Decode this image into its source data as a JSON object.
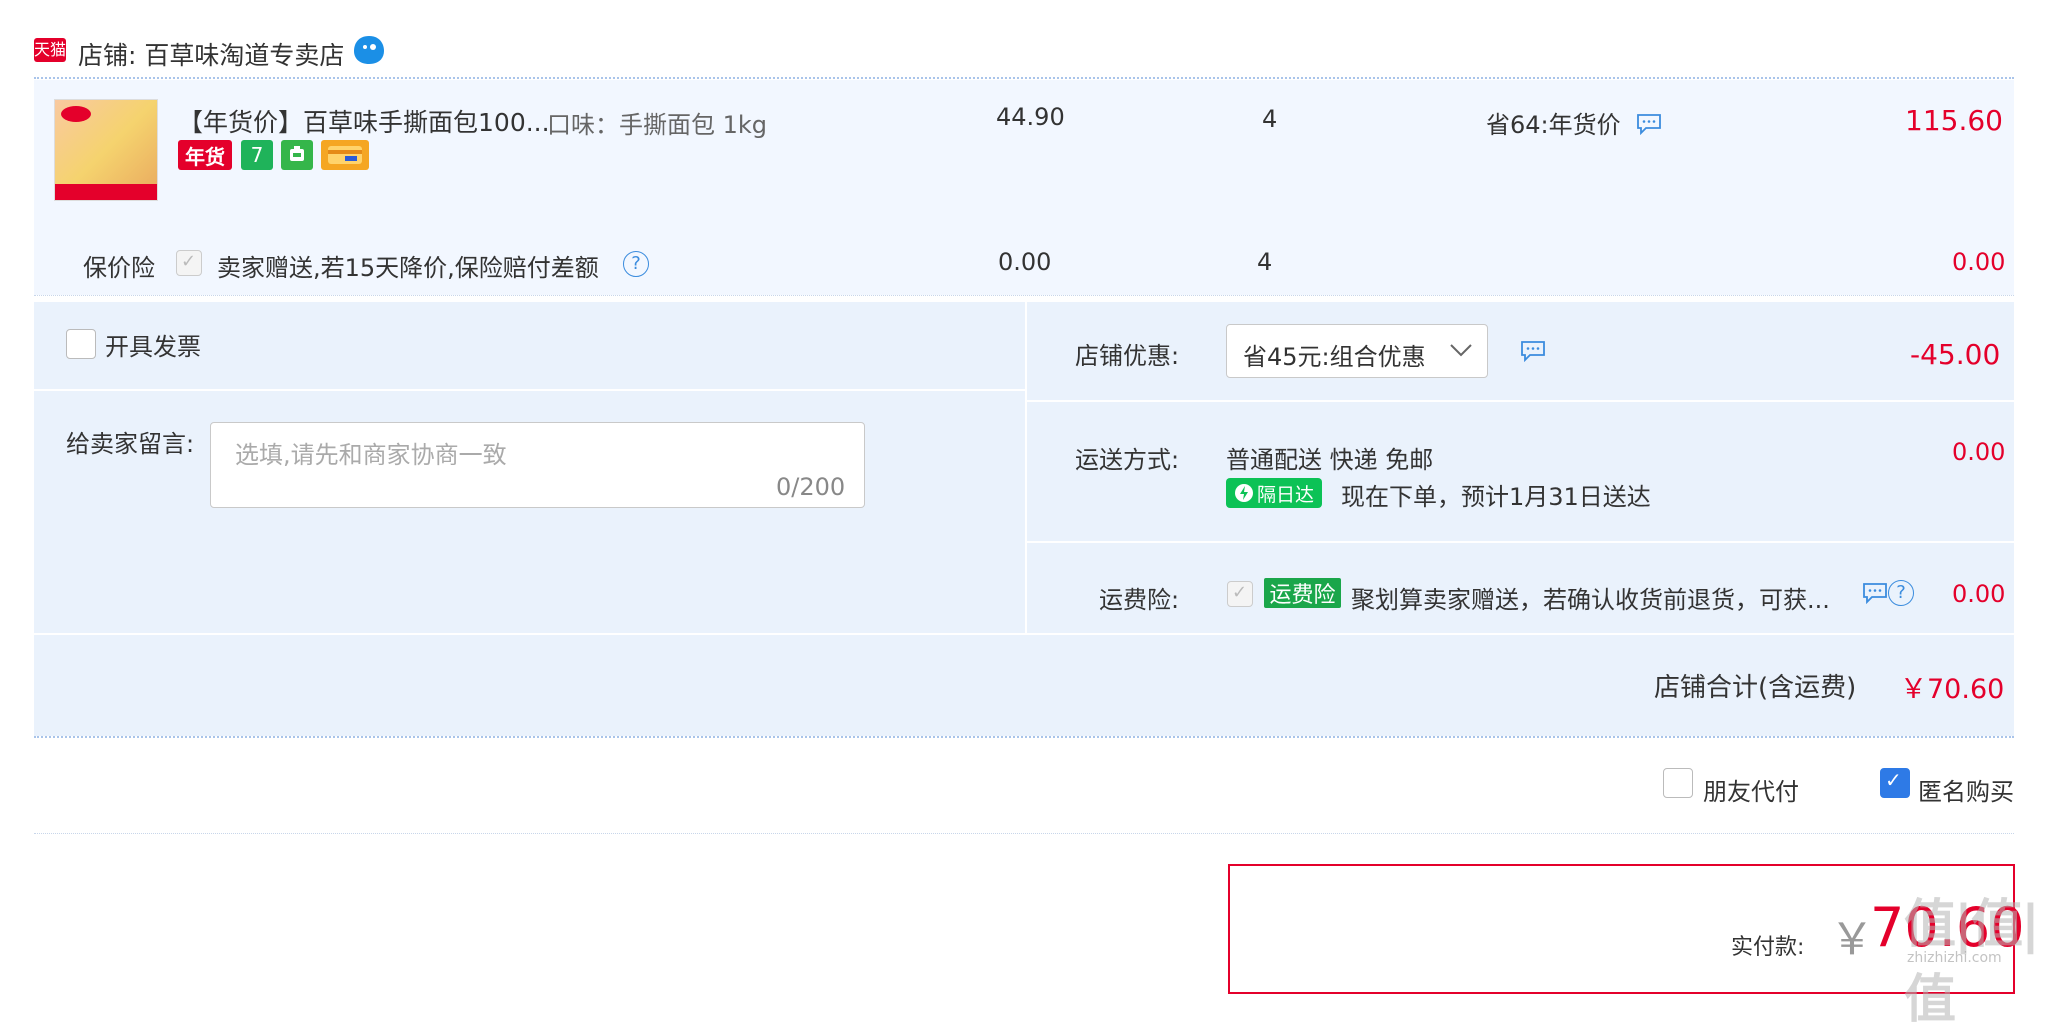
{
  "shop": {
    "logo_text": "天猫",
    "label": "店铺: 百草味淘道专卖店"
  },
  "item": {
    "title": "【年货价】百草味手撕面包100...",
    "sku": "口味：手撕面包 1kg",
    "badges": [
      "年货",
      "7",
      "",
      ""
    ],
    "price": "44.90",
    "quantity": "4",
    "promo": "省64:年货价",
    "subtotal": "115.60"
  },
  "insurance": {
    "label": "保价险",
    "text": "卖家赠送,若15天降价,保险赔付差额",
    "price": "0.00",
    "quantity": "4",
    "total": "0.00"
  },
  "invoice": {
    "label": "开具发票"
  },
  "memo": {
    "label": "给卖家留言:",
    "placeholder": "选填,请先和商家协商一致",
    "count": "0/200"
  },
  "discount": {
    "label": "店铺优惠:",
    "selected": "省45元:组合优惠",
    "total": "-45.00"
  },
  "shipping": {
    "label": "运送方式:",
    "method": "普通配送 快递 免邮",
    "badge": "隔日达",
    "eta": "现在下单，预计1月31日送达",
    "total": "0.00"
  },
  "freight_insurance": {
    "label": "运费险:",
    "badge": "运费险",
    "text": "聚划算卖家赠送，若确认收货前退货，可获...",
    "total": "0.00"
  },
  "shop_total": {
    "label": "店铺合计(含运费)",
    "value": "￥70.60"
  },
  "options": {
    "friend_pay": "朋友代付",
    "anonymous": "匿名购买",
    "anonymous_checked": true
  },
  "payment": {
    "label": "实付款:",
    "currency": "￥",
    "amount": "70.60"
  },
  "watermark": {
    "main": "值|值|值",
    "sub": "zhizhizhi.com"
  },
  "colors": {
    "accent_red": "#e4002b",
    "panel_bg": "#eaf2fc",
    "item_bg": "#f2f7ff",
    "check_blue": "#2e7ae6"
  }
}
